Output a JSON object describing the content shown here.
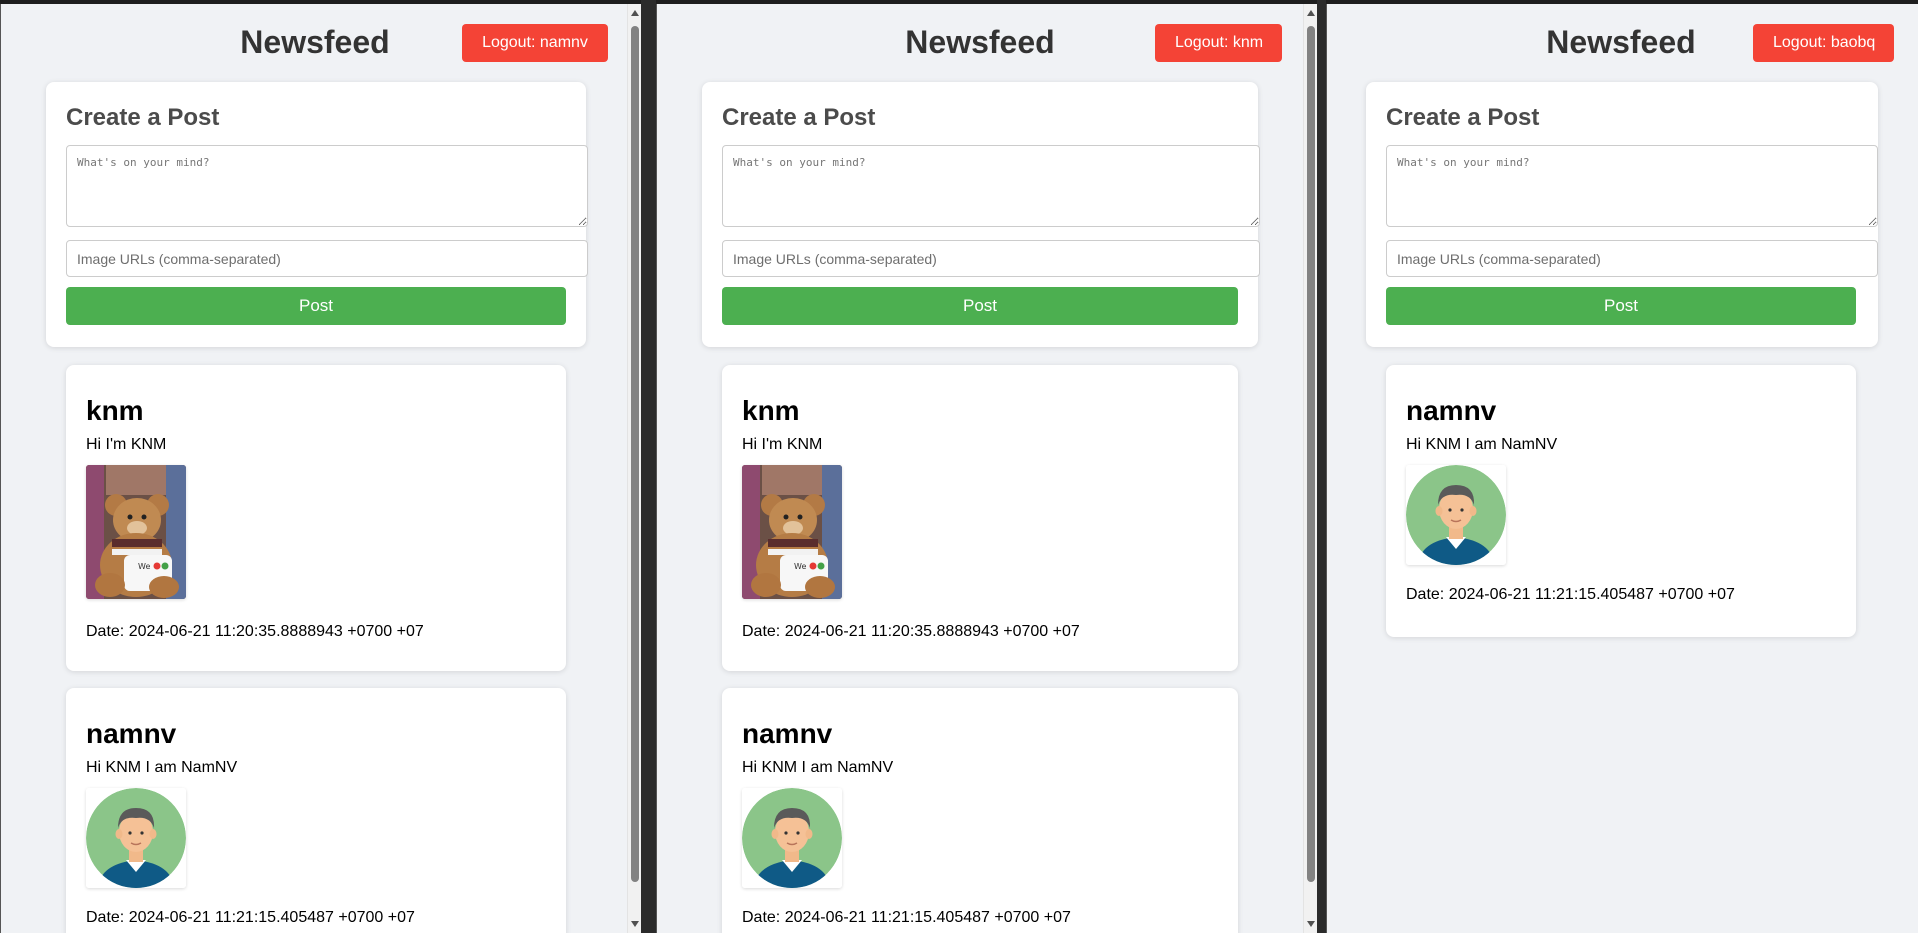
{
  "panes": [
    {
      "title": "Newsfeed",
      "logout_label": "Logout: namnv",
      "create_post": {
        "heading": "Create a Post",
        "content_placeholder": "What's on your mind?",
        "images_placeholder": "Image URLs (comma-separated)",
        "post_label": "Post"
      },
      "posts": [
        {
          "author": "knm",
          "content": "Hi I'm KNM",
          "image": "teddy-bear-photo",
          "date": "Date: 2024-06-21 11:20:35.8888943 +0700 +07"
        },
        {
          "author": "namnv",
          "content": "Hi KNM I am NamNV",
          "image": "man-avatar-illustration",
          "date": "Date: 2024-06-21 11:21:15.405487 +0700 +07"
        }
      ]
    },
    {
      "title": "Newsfeed",
      "logout_label": "Logout: knm",
      "create_post": {
        "heading": "Create a Post",
        "content_placeholder": "What's on your mind?",
        "images_placeholder": "Image URLs (comma-separated)",
        "post_label": "Post"
      },
      "posts": [
        {
          "author": "knm",
          "content": "Hi I'm KNM",
          "image": "teddy-bear-photo",
          "date": "Date: 2024-06-21 11:20:35.8888943 +0700 +07"
        },
        {
          "author": "namnv",
          "content": "Hi KNM I am NamNV",
          "image": "man-avatar-illustration",
          "date": "Date: 2024-06-21 11:21:15.405487 +0700 +07"
        }
      ]
    },
    {
      "title": "Newsfeed",
      "logout_label": "Logout: baobq",
      "create_post": {
        "heading": "Create a Post",
        "content_placeholder": "What's on your mind?",
        "images_placeholder": "Image URLs (comma-separated)",
        "post_label": "Post"
      },
      "posts": [
        {
          "author": "namnv",
          "content": "Hi KNM I am NamNV",
          "image": "man-avatar-illustration",
          "date": "Date: 2024-06-21 11:21:15.405487 +0700 +07"
        }
      ]
    }
  ],
  "colors": {
    "page_background": "#f0f2f5",
    "logout_button": "#f44336",
    "post_button": "#4caf50",
    "avatar_background": "#8bc589",
    "shirt": "#0f5a86"
  }
}
